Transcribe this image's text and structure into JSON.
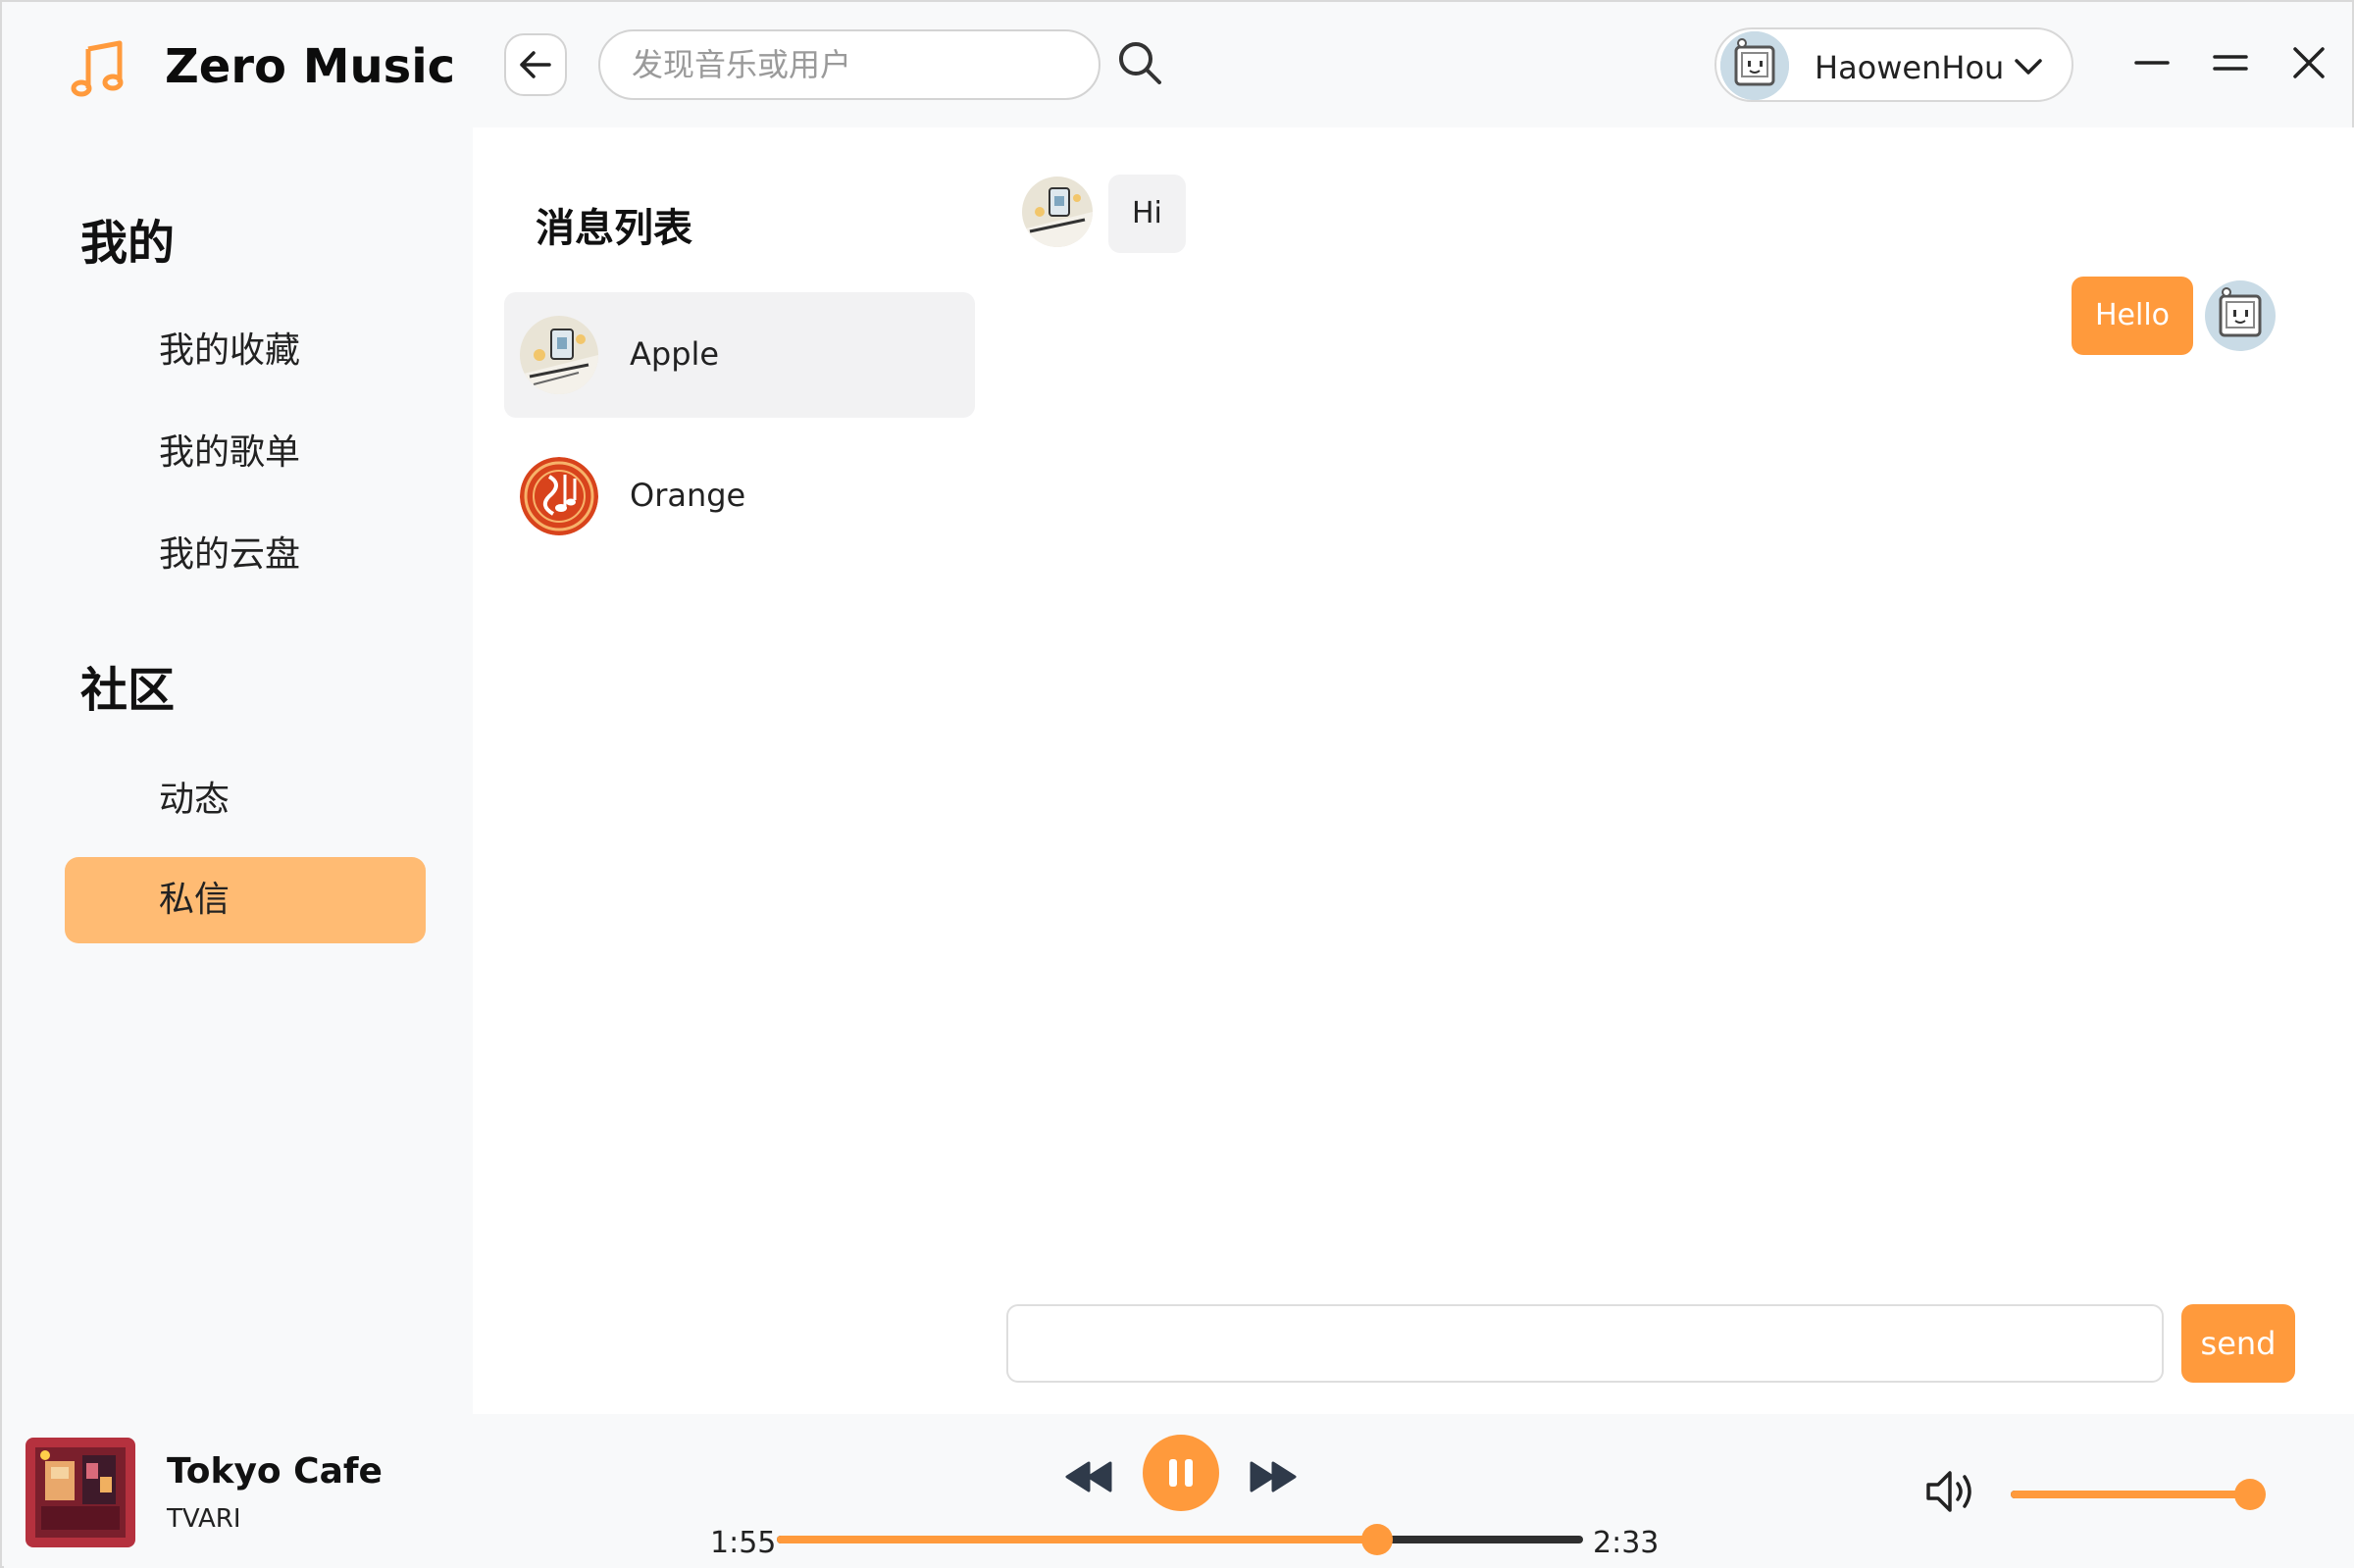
{
  "app": {
    "title": "Zero Music",
    "accent_color": "#ff9a3c",
    "active_nav_color": "#ffbb73"
  },
  "header": {
    "search_placeholder": "发现音乐或用户",
    "user_name": "HaowenHou"
  },
  "sidebar": {
    "sections": [
      {
        "title": "我的",
        "items": [
          "我的收藏",
          "我的歌单",
          "我的云盘"
        ]
      },
      {
        "title": "社区",
        "items": [
          "动态",
          "私信"
        ]
      }
    ],
    "active_item": "私信"
  },
  "messages": {
    "list_title": "消息列表",
    "conversations": [
      {
        "name": "Apple",
        "selected": true,
        "avatar": "robot-avatar"
      },
      {
        "name": "Orange",
        "selected": false,
        "avatar": "music-notes-avatar"
      }
    ],
    "chat": [
      {
        "direction": "incoming",
        "text": "Hi"
      },
      {
        "direction": "outgoing",
        "text": "Hello"
      }
    ],
    "input_value": "",
    "send_label": "send"
  },
  "player": {
    "song_title": "Tokyo Cafe",
    "artist": "TVARI",
    "elapsed": "1:55",
    "duration": "2:33",
    "progress_fraction": 0.745,
    "volume_fraction": 1.0,
    "state": "playing"
  }
}
